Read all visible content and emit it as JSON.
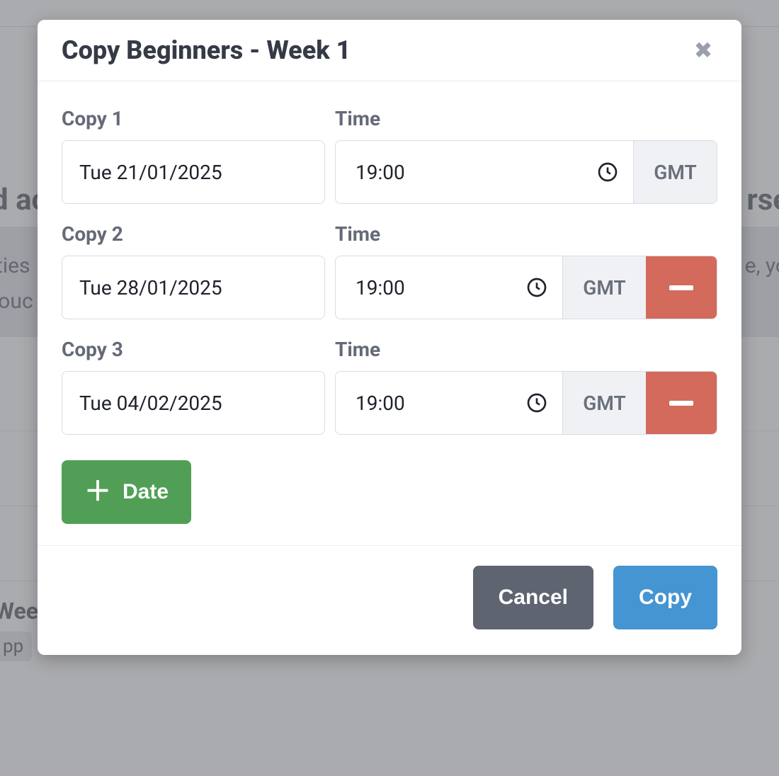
{
  "background": {
    "heading_left": "d ac",
    "heading_right": "rse",
    "band_line1": "ties",
    "band_line2": "louc",
    "band_line_right": "e, yo",
    "partial_label": "Wee",
    "partial_button": "pp"
  },
  "modal": {
    "title": "Copy Beginners - Week 1",
    "add_date_label": "Date",
    "footer": {
      "cancel": "Cancel",
      "confirm": "Copy"
    },
    "rows": [
      {
        "copy_label": "Copy 1",
        "time_label": "Time",
        "date_value": "Tue 21/01/2025",
        "time_value": "19:00",
        "tz": "GMT",
        "removable": false
      },
      {
        "copy_label": "Copy 2",
        "time_label": "Time",
        "date_value": "Tue 28/01/2025",
        "time_value": "19:00",
        "tz": "GMT",
        "removable": true
      },
      {
        "copy_label": "Copy 3",
        "time_label": "Time",
        "date_value": "Tue 04/02/2025",
        "time_value": "19:00",
        "tz": "GMT",
        "removable": true
      }
    ]
  }
}
